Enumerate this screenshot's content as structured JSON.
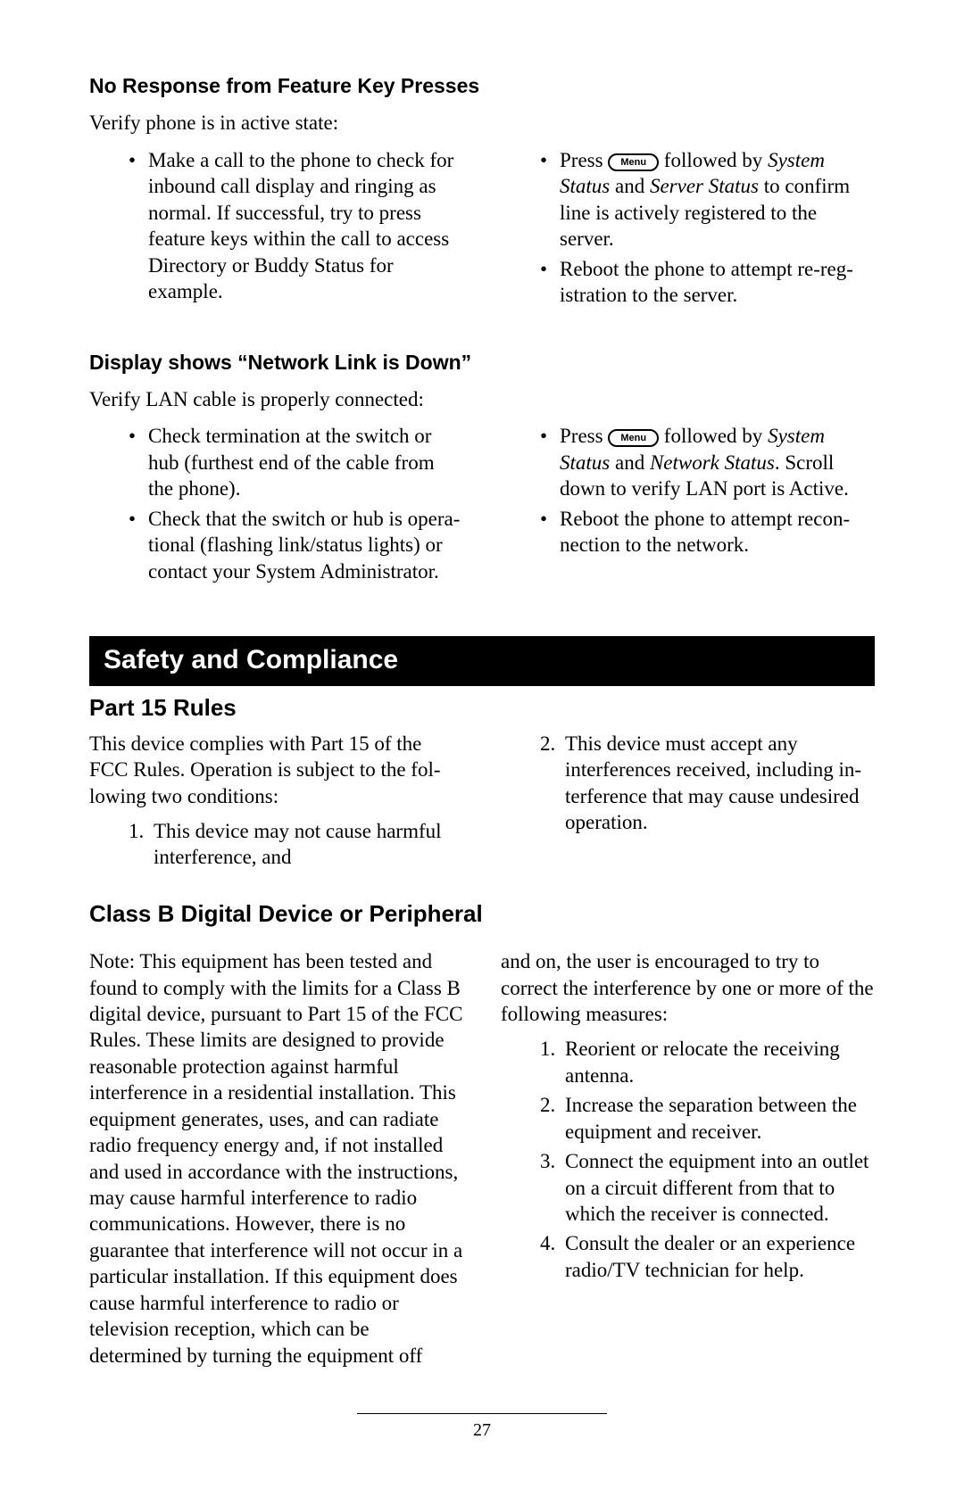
{
  "section1": {
    "heading": "No Response from Feature Key Presses",
    "lead": "Verify phone is in active state:",
    "left_bullets": [
      "Make a call to the phone to check for inbound call display and ring­ing as normal.  If successful, try to press feature keys within the call to access Directory or Buddy Status for example."
    ],
    "right_b1_pre": "Press ",
    "menu_label": "Menu",
    "right_b1_mid": " followed by ",
    "right_b1_i1": "System Status",
    "right_b1_and": " and ",
    "right_b1_i2": "Server Status",
    "right_b1_post": " to confirm line is actively registered to the server.",
    "right_b2": "Reboot the phone to attempt re-reg­istration to the server."
  },
  "section2": {
    "heading": "Display shows “Network Link is Down”",
    "lead": "Verify LAN cable is properly connected:",
    "left_bullets": [
      "Check termination at the switch or hub (furthest end of the cable from the phone).",
      "Check that the switch or hub is opera­tional (flashing link/status lights) or contact your System Administrator."
    ],
    "right_b1_pre": "Press ",
    "right_b1_mid": " followed by ",
    "right_b1_i1": "System Status",
    "right_b1_and": " and ",
    "right_b1_i2": "Network Status",
    "right_b1_post": ".  Scroll down to verify LAN port is Active.",
    "right_b2": "Reboot the phone to attempt recon­nection to the network."
  },
  "safety_bar": "Safety and Compliance",
  "part15": {
    "heading": "Part 15 Rules",
    "lead": "This device complies with Part 15 of the FCC Rules.  Operation is subject to the fol­lowing two conditions:",
    "item1_num": "1.",
    "item1_text": "This device may not cause harmful interference, and",
    "item2_num": "2.",
    "item2_text": "This device must accept any interferences received, including in­terference that may cause undesired operation."
  },
  "classb": {
    "heading": "Class B Digital Device or Peripheral",
    "left_para": "Note:  This equipment has been tested and found to comply with the limits for a Class B digital device, pursuant to Part 15 of the FCC Rules.  These limits are designed to provide reasonable protection against harm­ful interference in a residential installation.  This equipment generates, uses, and can radiate radio frequency energy and, if not installed and used in accordance with the instructions, may cause harmful interfer­ence to radio communications.  However, there is no guarantee that interference will not occur in a particular installation.  If this equipment does cause harmful interference to radio or television reception, which can be determined by turning the equipment off",
    "right_lead": "and on, the user is encouraged to try to correct the interference by one or more of the following measures:",
    "m1_num": "1.",
    "m1_text": "Reorient or relocate the receiving antenna.",
    "m2_num": "2.",
    "m2_text": "Increase the separation between the equipment and receiver.",
    "m3_num": "3.",
    "m3_text": "Connect the equipment into an out­let on a circuit different from that to which the receiver is connected.",
    "m4_num": "4.",
    "m4_text": "Consult the dealer or an experience radio/TV technician for help."
  },
  "page_number": "27"
}
